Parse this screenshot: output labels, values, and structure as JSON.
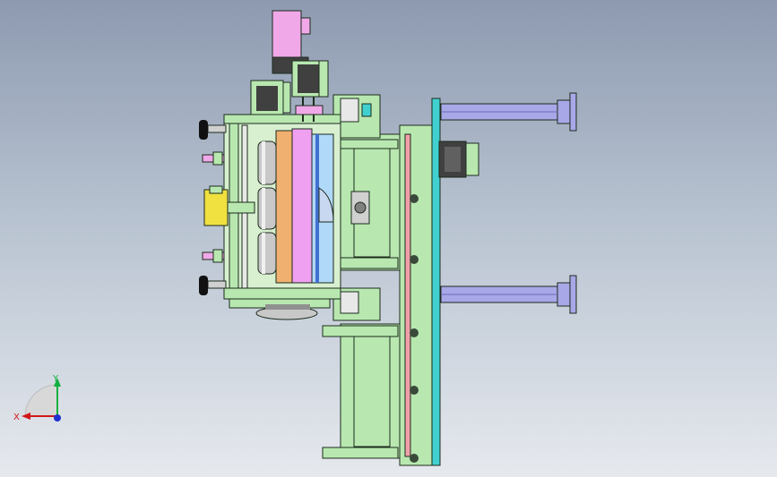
{
  "axis_triad": {
    "x_label": "X",
    "y_label": "Y",
    "colors": {
      "x": "#d01818",
      "y": "#10b040",
      "z": "#2030d0"
    }
  },
  "model": {
    "part_colors": {
      "frame_green": "#b8e8b0",
      "frame_outline": "#1c2a1c",
      "motor_pink": "#f0a8e8",
      "motor_dark": "#404040",
      "magenta_plate": "#f0a0f0",
      "orange_plate": "#f0b070",
      "blue_plate": "#80b8f0",
      "cyan_rail": "#40d0d0",
      "cylinder_purple": "#a8a8e8",
      "roller_gray": "#c8c8c8",
      "knob_black": "#111111",
      "yellow_block": "#f0e040"
    }
  }
}
